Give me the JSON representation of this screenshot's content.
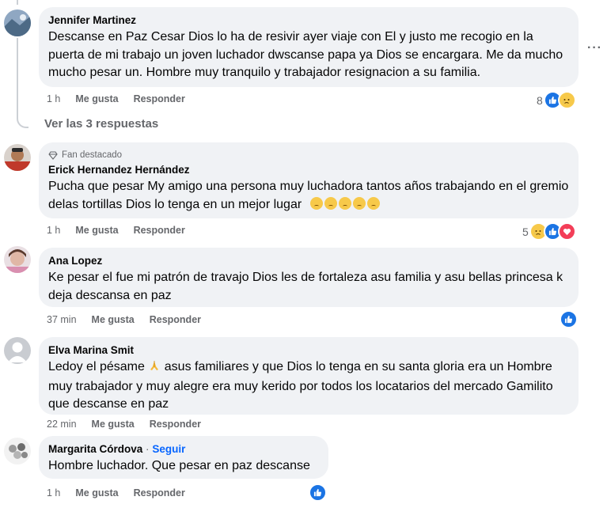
{
  "comments": [
    {
      "author": "Jennifer Martinez",
      "text": "Descanse en Paz Cesar Dios lo ha de resivir ayer viaje con El y justo me recogio en la puerta de mi trabajo un joven luchador dwscanse papa ya Dios se encargara. Me da mucho mucho pesar un. Hombre muy tranquilo y trabajador resignacion a su familia.",
      "time": "1 h",
      "like_label": "Me gusta",
      "reply_label": "Responder",
      "reaction_count": "8",
      "reactions": [
        "like-icon",
        "sad-icon"
      ]
    },
    {
      "badge": "Fan destacado",
      "author": "Erick Hernandez Hernández",
      "text": "Pucha que pesar My amigo una persona muy luchadora tantos años trabajando en el gremio delas tortillas Dios lo tenga en un mejor lugar",
      "time": "1 h",
      "like_label": "Me gusta",
      "reply_label": "Responder",
      "reaction_count": "5",
      "reactions": [
        "sad-icon",
        "like-icon",
        "love-icon"
      ]
    },
    {
      "author": "Ana Lopez",
      "text": "Ke pesar el fue mi patrón de travajo Dios les de fortaleza asu familia y asu bellas princesa k deja descansa en paz",
      "time": "37 min",
      "like_label": "Me gusta",
      "reply_label": "Responder",
      "reactions": [
        "like-icon"
      ]
    },
    {
      "author": "Elva Marina Smit",
      "text_before": "Ledoy el pésame",
      "text_after": "asus familiares y que Dios lo tenga en su santa gloria era un Hombre muy trabajador y muy alegre era muy kerido por todos los locatarios del mercado Gamilito que descanse en paz",
      "time": "22 min",
      "like_label": "Me gusta",
      "reply_label": "Responder"
    },
    {
      "author": "Margarita Córdova",
      "separator": "·",
      "follow_label": "Seguir",
      "text": "Hombre luchador. Que pesar en paz descanse",
      "time": "1 h",
      "like_label": "Me gusta",
      "reply_label": "Responder",
      "reactions": [
        "like-icon"
      ]
    }
  ],
  "view_replies_label": "Ver las 3 respuestas",
  "more_options_label": "···",
  "colors": {
    "bubble": "#f0f2f5",
    "secondary_text": "#65676b",
    "like_blue": "#1b74e4",
    "follow_blue": "#0866ff",
    "thread_line": "#ccd0d5"
  }
}
